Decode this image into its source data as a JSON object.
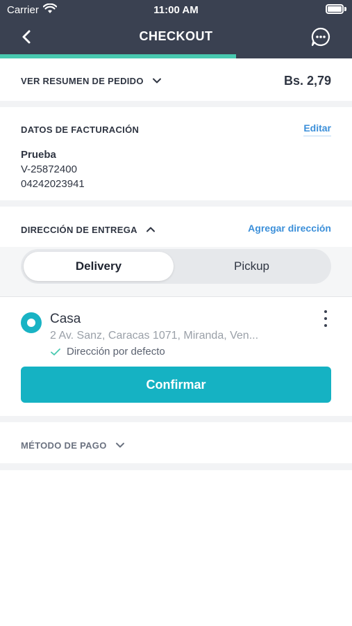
{
  "status_bar": {
    "carrier": "Carrier",
    "time": "11:00 AM"
  },
  "nav": {
    "title": "CHECKOUT",
    "back_icon": "chevron-left-icon",
    "chat_icon": "chat-bubble-icon"
  },
  "progress": {
    "fraction": 0.67,
    "color": "#48c9b0"
  },
  "order_summary": {
    "label": "VER RESUMEN DE PEDIDO",
    "total": "Bs. 2,79"
  },
  "billing": {
    "title": "DATOS DE FACTURACIÓN",
    "edit_label": "Editar",
    "name": "Prueba",
    "id_number": "V-25872400",
    "phone": "04242023941"
  },
  "delivery": {
    "title": "DIRECCIÓN DE ENTREGA",
    "add_label": "Agregar dirección",
    "options": [
      "Delivery",
      "Pickup"
    ],
    "selected_option": "Delivery",
    "address": {
      "name": "Casa",
      "text": "2 Av. Sanz, Caracas 1071, Miranda, Ven...",
      "default_label": "Dirección por defecto"
    },
    "confirm_label": "Confirmar"
  },
  "payment": {
    "title": "MÉTODO DE PAGO"
  },
  "colors": {
    "header": "#3a4151",
    "accent": "#15b2c3",
    "link": "#3b8fd9"
  }
}
